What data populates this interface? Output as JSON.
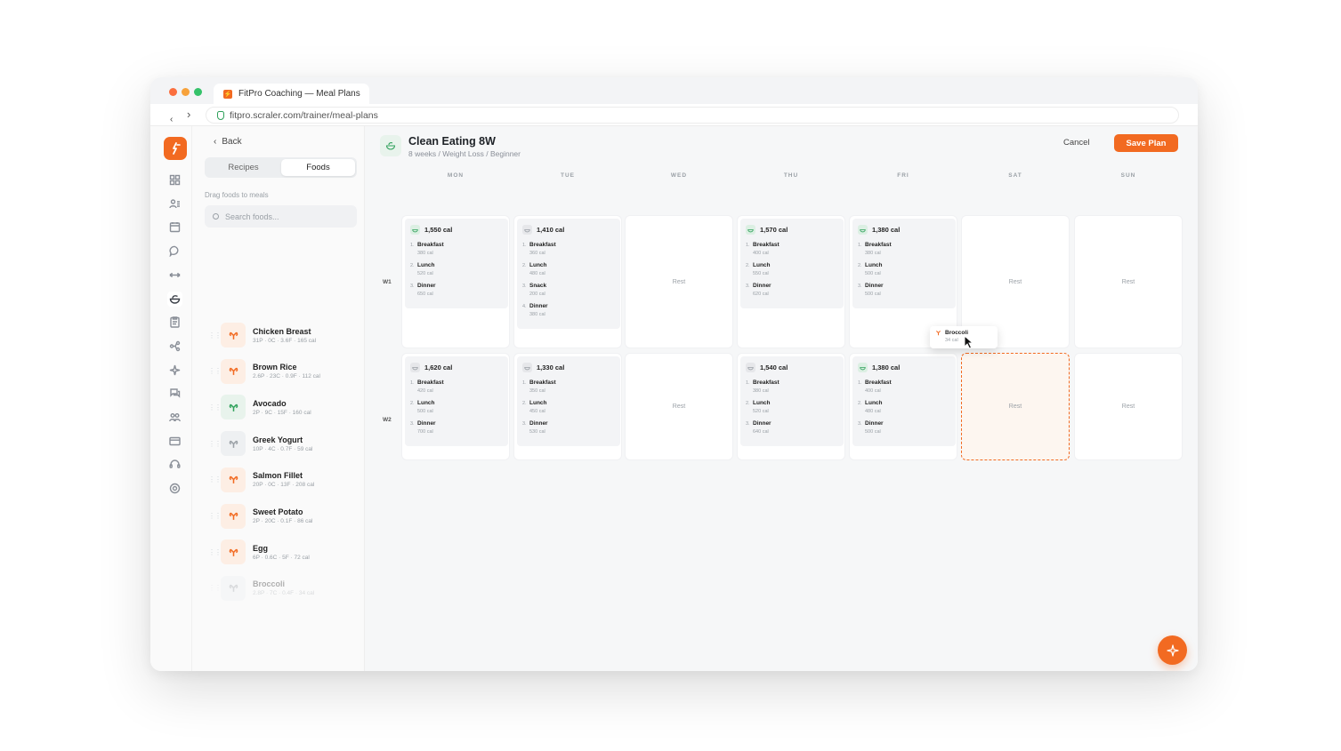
{
  "browser": {
    "tab_title": "FitPro Coaching — Meal Plans",
    "url": "fitpro.scraler.com/trainer/meal-plans"
  },
  "rail": {
    "items": [
      "dashboard-icon",
      "clients-icon",
      "calendar-icon",
      "chat-icon",
      "workouts-icon",
      "meal-plans-icon",
      "forms-icon",
      "automations-icon",
      "ai-icon",
      "messages-icon",
      "team-icon",
      "billing-icon",
      "support-icon",
      "settings-icon"
    ],
    "active": "meal-plans-icon"
  },
  "panel": {
    "back_label": "Back",
    "tabs": [
      "Recipes",
      "Foods"
    ],
    "active_tab": "Foods",
    "hint": "Drag foods to meals",
    "search_placeholder": "Search foods...",
    "foods": [
      {
        "name": "Chicken Breast",
        "macros": "31P · 0C · 3.6F · 165 cal",
        "tint": "orange"
      },
      {
        "name": "Brown Rice",
        "macros": "2.6P · 23C · 0.9F · 112 cal",
        "tint": "orange"
      },
      {
        "name": "Avocado",
        "macros": "2P · 9C · 15F · 160 cal",
        "tint": "green"
      },
      {
        "name": "Greek Yogurt",
        "macros": "10P · 4C · 0.7F · 59 cal",
        "tint": "neutral"
      },
      {
        "name": "Salmon Fillet",
        "macros": "20P · 0C · 13F · 208 cal",
        "tint": "orange"
      },
      {
        "name": "Sweet Potato",
        "macros": "2P · 20C · 0.1F · 86 cal",
        "tint": "orange"
      },
      {
        "name": "Egg",
        "macros": "6P · 0.6C · 5F · 72 cal",
        "tint": "orange"
      },
      {
        "name": "Broccoli",
        "macros": "2.8P · 7C · 0.4F · 34 cal",
        "tint": "neutral",
        "dragging": true
      }
    ]
  },
  "plan": {
    "title": "Clean Eating 8W",
    "subtitle": "8 weeks / Weight Loss / Beginner",
    "cancel_label": "Cancel",
    "save_label": "Save Plan",
    "days": [
      "MON",
      "TUE",
      "WED",
      "THU",
      "FRI",
      "SAT",
      "SUN"
    ],
    "rest_label": "Rest",
    "weeks": [
      {
        "label": "W1",
        "days": [
          {
            "kcal": "1,550 cal",
            "meals": [
              {
                "name": "Breakfast",
                "cal": "380 cal"
              },
              {
                "name": "Lunch",
                "cal": "520 cal"
              },
              {
                "name": "Dinner",
                "cal": "650 cal"
              }
            ]
          },
          {
            "kcal": "1,410 cal",
            "meals": [
              {
                "name": "Breakfast",
                "cal": "360 cal"
              },
              {
                "name": "Lunch",
                "cal": "480 cal"
              },
              {
                "name": "Snack",
                "cal": "200 cal"
              },
              {
                "name": "Dinner",
                "cal": "380 cal"
              }
            ]
          },
          null,
          {
            "kcal": "1,570 cal",
            "meals": [
              {
                "name": "Breakfast",
                "cal": "400 cal"
              },
              {
                "name": "Lunch",
                "cal": "550 cal"
              },
              {
                "name": "Dinner",
                "cal": "620 cal"
              }
            ]
          },
          {
            "kcal": "1,380 cal",
            "meals": [
              {
                "name": "Breakfast",
                "cal": "380 cal"
              },
              {
                "name": "Lunch",
                "cal": "500 cal"
              },
              {
                "name": "Dinner",
                "cal": "500 cal"
              }
            ]
          },
          null,
          null
        ]
      },
      {
        "label": "W2",
        "days": [
          {
            "kcal": "1,620 cal",
            "meals": [
              {
                "name": "Breakfast",
                "cal": "420 cal"
              },
              {
                "name": "Lunch",
                "cal": "500 cal"
              },
              {
                "name": "Dinner",
                "cal": "700 cal"
              }
            ]
          },
          {
            "kcal": "1,330 cal",
            "meals": [
              {
                "name": "Breakfast",
                "cal": "350 cal"
              },
              {
                "name": "Lunch",
                "cal": "450 cal"
              },
              {
                "name": "Dinner",
                "cal": "530 cal"
              }
            ]
          },
          null,
          {
            "kcal": "1,540 cal",
            "meals": [
              {
                "name": "Breakfast",
                "cal": "380 cal"
              },
              {
                "name": "Lunch",
                "cal": "520 cal"
              },
              {
                "name": "Dinner",
                "cal": "640 cal"
              }
            ]
          },
          {
            "kcal": "1,380 cal",
            "meals": [
              {
                "name": "Breakfast",
                "cal": "400 cal"
              },
              {
                "name": "Lunch",
                "cal": "480 cal"
              },
              {
                "name": "Dinner",
                "cal": "500 cal"
              }
            ]
          },
          null,
          null
        ]
      }
    ],
    "drop_target": {
      "week": 1,
      "day": 5
    }
  },
  "drag": {
    "name": "Broccoli",
    "cal": "34 cal"
  },
  "colors": {
    "accent": "#f26a21",
    "green_tint": "#e8f3ec",
    "orange_tint": "#fdeee4"
  }
}
